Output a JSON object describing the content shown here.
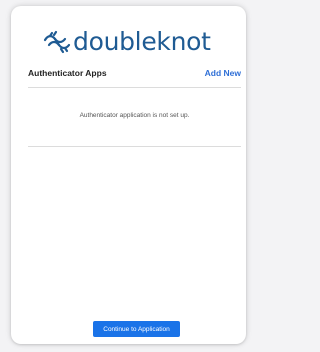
{
  "brand": {
    "logo_text": "doubleknot",
    "logo_icon": "doubleknot-knot-icon",
    "color": "#1f5b93"
  },
  "section": {
    "title": "Authenticator Apps",
    "add_new_label": "Add New",
    "empty_message": "Authenticator application is not set up."
  },
  "footer": {
    "continue_label": "Continue to Application",
    "button_color": "#1a73e8"
  },
  "colors": {
    "link": "#2f6fd6",
    "divider": "#dcdcdc",
    "background": "#f3f3f5"
  }
}
